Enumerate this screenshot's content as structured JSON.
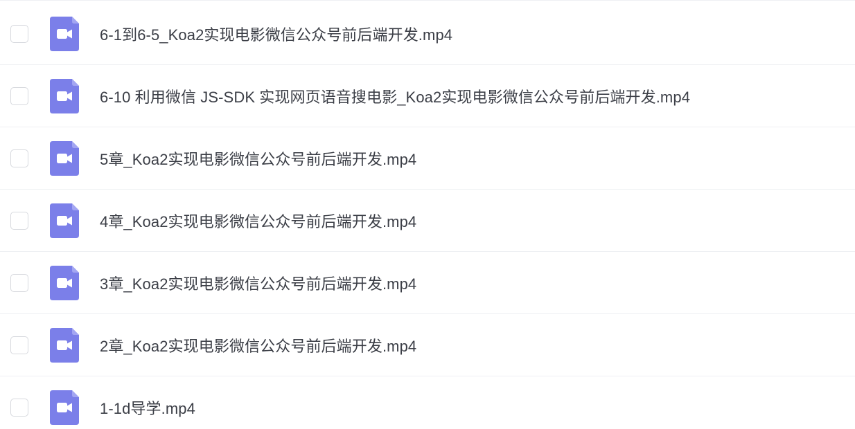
{
  "files": [
    {
      "name": "6-1到6-5_Koa2实现电影微信公众号前后端开发.mp4",
      "icon": "video-file-icon"
    },
    {
      "name": "6-10 利用微信 JS-SDK 实现网页语音搜电影_Koa2实现电影微信公众号前后端开发.mp4",
      "icon": "video-file-icon"
    },
    {
      "name": "5章_Koa2实现电影微信公众号前后端开发.mp4",
      "icon": "video-file-icon"
    },
    {
      "name": "4章_Koa2实现电影微信公众号前后端开发.mp4",
      "icon": "video-file-icon"
    },
    {
      "name": "3章_Koa2实现电影微信公众号前后端开发.mp4",
      "icon": "video-file-icon"
    },
    {
      "name": "2章_Koa2实现电影微信公众号前后端开发.mp4",
      "icon": "video-file-icon"
    },
    {
      "name": "1-1d导学.mp4",
      "icon": "video-file-icon"
    }
  ],
  "colors": {
    "icon_fill": "#7b7fe9",
    "icon_fold": "#a3a6f2",
    "text": "#3b3e46",
    "divider": "#eef0f3",
    "checkbox_border": "#d7d9de"
  }
}
